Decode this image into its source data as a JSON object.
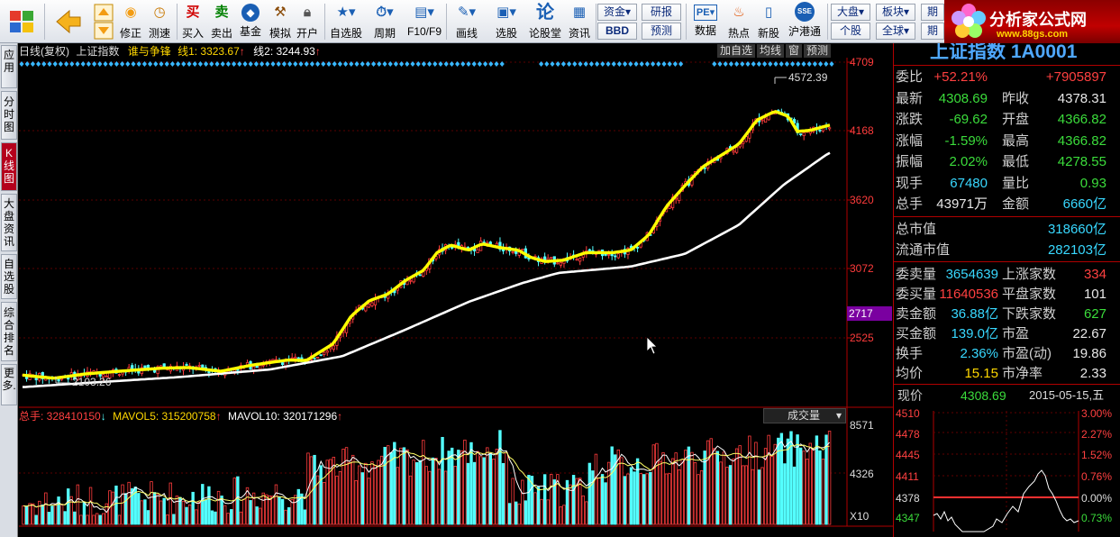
{
  "toolbar": {
    "buttons": [
      {
        "label": "修正",
        "icon": "sun-icon"
      },
      {
        "label": "测速",
        "icon": "clock-icon"
      },
      {
        "label": "买入",
        "icon": "buy-icon"
      },
      {
        "label": "卖出",
        "icon": "sell-icon"
      },
      {
        "label": "基金",
        "icon": "fund-icon"
      },
      {
        "label": "模拟",
        "icon": "hammer-icon"
      },
      {
        "label": "开户",
        "icon": "lock-icon"
      },
      {
        "label": "自选股",
        "icon": "star-list-icon"
      },
      {
        "label": "周期",
        "icon": "period-icon"
      },
      {
        "label": "F10/F9",
        "icon": "f10-icon"
      },
      {
        "label": "画线",
        "icon": "pencil-icon"
      },
      {
        "label": "选股",
        "icon": "screener-icon"
      },
      {
        "label": "论股堂",
        "icon": "forum-icon"
      },
      {
        "label": "资讯",
        "icon": "news-icon"
      },
      {
        "label": "数据",
        "icon": "pe-icon"
      },
      {
        "label": "热点",
        "icon": "hot-icon"
      },
      {
        "label": "新股",
        "icon": "ipo-icon"
      },
      {
        "label": "沪港通",
        "icon": "sse-hke-icon"
      }
    ],
    "mini": [
      {
        "label": "资金"
      },
      {
        "label": "研报"
      },
      {
        "label": "BBD"
      },
      {
        "label": "预测"
      },
      {
        "label": "大盘"
      },
      {
        "label": "板块"
      },
      {
        "label": "个股"
      },
      {
        "label": "全球"
      },
      {
        "label": "期"
      },
      {
        "label": "期"
      }
    ],
    "logo_title": "分析家公式网",
    "logo_url": "www.88gs.com"
  },
  "left_tabs": [
    "应用",
    "分时图",
    "K线图",
    "大盘资讯",
    "自选股",
    "综合排名",
    "更多."
  ],
  "chart": {
    "header": {
      "title": "日线(复权)",
      "name": "上证指数",
      "indicator": "谁与争锋",
      "line1_label": "线1: 3323.67",
      "line1_arrow": "↑",
      "line2_label": "线2: 3244.93",
      "line2_arrow": "↑"
    },
    "buttons": [
      "加自选",
      "均线",
      "窗",
      "预测"
    ],
    "price_axis": [
      "4709",
      "4168",
      "3620",
      "3072",
      "2525"
    ],
    "cursor_price": "2717",
    "high_marker": "4572.39",
    "low_marker": "2103.26",
    "volume": {
      "total_label": "总手: 328410150",
      "total_arrow": "↓",
      "mavol5": "MAVOL5: 315200758",
      "mavol5_arrow": "↑",
      "mavol10": "MAVOL10: 320171296",
      "mavol10_arrow": "↑",
      "selector": "成交量",
      "axis": [
        "8571",
        "4326"
      ],
      "unit": "X10"
    }
  },
  "quote": {
    "title": "上证指数 1A0001",
    "rows": [
      {
        "k1": "委比",
        "v1": "+52.21%",
        "c1": "red",
        "k2": "",
        "v2": "+7905897",
        "c2": "red"
      },
      {
        "k1": "最新",
        "v1": "4308.69",
        "c1": "green",
        "k2": "昨收",
        "v2": "4378.31",
        "c2": "white"
      },
      {
        "k1": "涨跌",
        "v1": "-69.62",
        "c1": "green",
        "k2": "开盘",
        "v2": "4366.82",
        "c2": "green"
      },
      {
        "k1": "涨幅",
        "v1": "-1.59%",
        "c1": "green",
        "k2": "最高",
        "v2": "4366.82",
        "c2": "green"
      },
      {
        "k1": "振幅",
        "v1": "2.02%",
        "c1": "green",
        "k2": "最低",
        "v2": "4278.55",
        "c2": "green"
      },
      {
        "k1": "现手",
        "v1": "67480",
        "c1": "cyan",
        "k2": "量比",
        "v2": "0.93",
        "c2": "green"
      },
      {
        "k1": "总手",
        "v1": "43971万",
        "c1": "white",
        "k2": "金额",
        "v2": "6660亿",
        "c2": "cyan"
      }
    ],
    "cap_rows": [
      {
        "k": "总市值",
        "v": "318660亿"
      },
      {
        "k": "流通市值",
        "v": "282103亿"
      }
    ],
    "stat_rows": [
      {
        "k1": "委卖量",
        "v1": "3654639",
        "c1": "cyan",
        "k2": "上涨家数",
        "v2": "334",
        "c2": "red"
      },
      {
        "k1": "委买量",
        "v1": "11640536",
        "c1": "red",
        "k2": "平盘家数",
        "v2": "101",
        "c2": "white"
      },
      {
        "k1": "卖金额",
        "v1": "36.88亿",
        "c1": "cyan",
        "k2": "下跌家数",
        "v2": "627",
        "c2": "green"
      },
      {
        "k1": "买金额",
        "v1": "139.0亿",
        "c1": "cyan",
        "k2": "市盈",
        "v2": "22.67",
        "c2": "white"
      },
      {
        "k1": "换手",
        "v1": "2.36%",
        "c1": "cyan",
        "k2": "市盈(动)",
        "v2": "19.86",
        "c2": "white"
      },
      {
        "k1": "均价",
        "v1": "15.15",
        "c1": "yellow",
        "k2": "市净率",
        "v2": "2.33",
        "c2": "white"
      }
    ],
    "current_label": "现价",
    "current_value": "4308.69",
    "date": "2015-05-15,五",
    "mini_axis_left": [
      "4510",
      "4478",
      "4445",
      "4411",
      "4378",
      "4347"
    ],
    "mini_axis_right": [
      "3.00%",
      "2.27%",
      "1.52%",
      "0.76%",
      "0.00%",
      "0.73%"
    ]
  },
  "colors": {
    "up": "#ff3c3c",
    "down": "#54ffff",
    "ma_yellow": "#ffff00",
    "ma_white": "#ffffff",
    "panel_border": "#b00000"
  }
}
